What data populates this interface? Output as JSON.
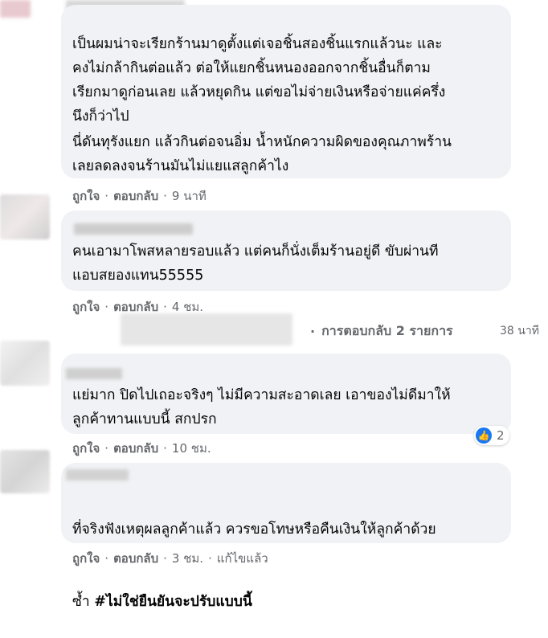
{
  "comments": [
    {
      "paragraphs": [
        "เป็นผมน่าจะเรียกร้านมาดูตั้งแต่เจอชิ้นสองชิ้นแรกแล้วนะ และ\nคงไม่กล้ากินต่อแล้ว ต่อให้แยกชิ้นหนองออกจากชิ้นอื่นก็ตาม\nเรียกมาดูก่อนเลย แล้วหยุดกิน แต่ขอไม่จ่ายเงินหรือจ่ายแค่ครึ่ง\nนึงก็ว่าไป",
        "นี่ดันทุรังแยก แล้วกินต่อจนอิ่ม น้ำหนักความผิดของคุณภาพร้าน\nเลยลดลงจนร้านมันไม่แยแสลูกค้าไง"
      ],
      "like_label": "ถูกใจ",
      "reply_label": "ตอบกลับ",
      "time": "9 นาที"
    },
    {
      "text": "คนเอามาโพสหลายรอบแล้ว แต่คนก็นั่งเต็มร้านอยู่ดี ขับผ่านที\nแอบสยองแทน55555",
      "like_label": "ถูกใจ",
      "reply_label": "ตอบกลับ",
      "time": "4 ชม."
    },
    {
      "text": "แย่มาก ปิดไปเถอะจริงๆ ไม่มีความสะอาดเลย เอาของไม่ดีมาให้\nลูกค้าทานแบบนี้ สกปรก",
      "like_label": "ถูกใจ",
      "reply_label": "ตอบกลับ",
      "time": "10 ชม.",
      "reaction_count": "2"
    },
    {
      "text_line1": "ที่จริงฟังเหตุผลลูกค้าแล้ว ควรขอโทษหรือคืนเงินให้ลูกค้าด้วย",
      "text_line2_plain": "ซ้ำ ",
      "hashtag": "#ไม่ใช่ยืนยันจะปรับแบบนี้",
      "like_label": "ถูกใจ",
      "reply_label": "ตอบกลับ",
      "time": "3 ชม.",
      "edited_label": "แก้ไขแล้ว"
    }
  ],
  "replies_link": {
    "label": "การตอบกลับ 2 รายการ",
    "time": "38 นาที"
  },
  "icons": {
    "reply-arrow": "arrow-icon",
    "like": "thumbs-up-icon"
  },
  "colors": {
    "bubble": "#f0f2f5",
    "meta_text": "#65676b",
    "like_blue": "#1877f2"
  }
}
